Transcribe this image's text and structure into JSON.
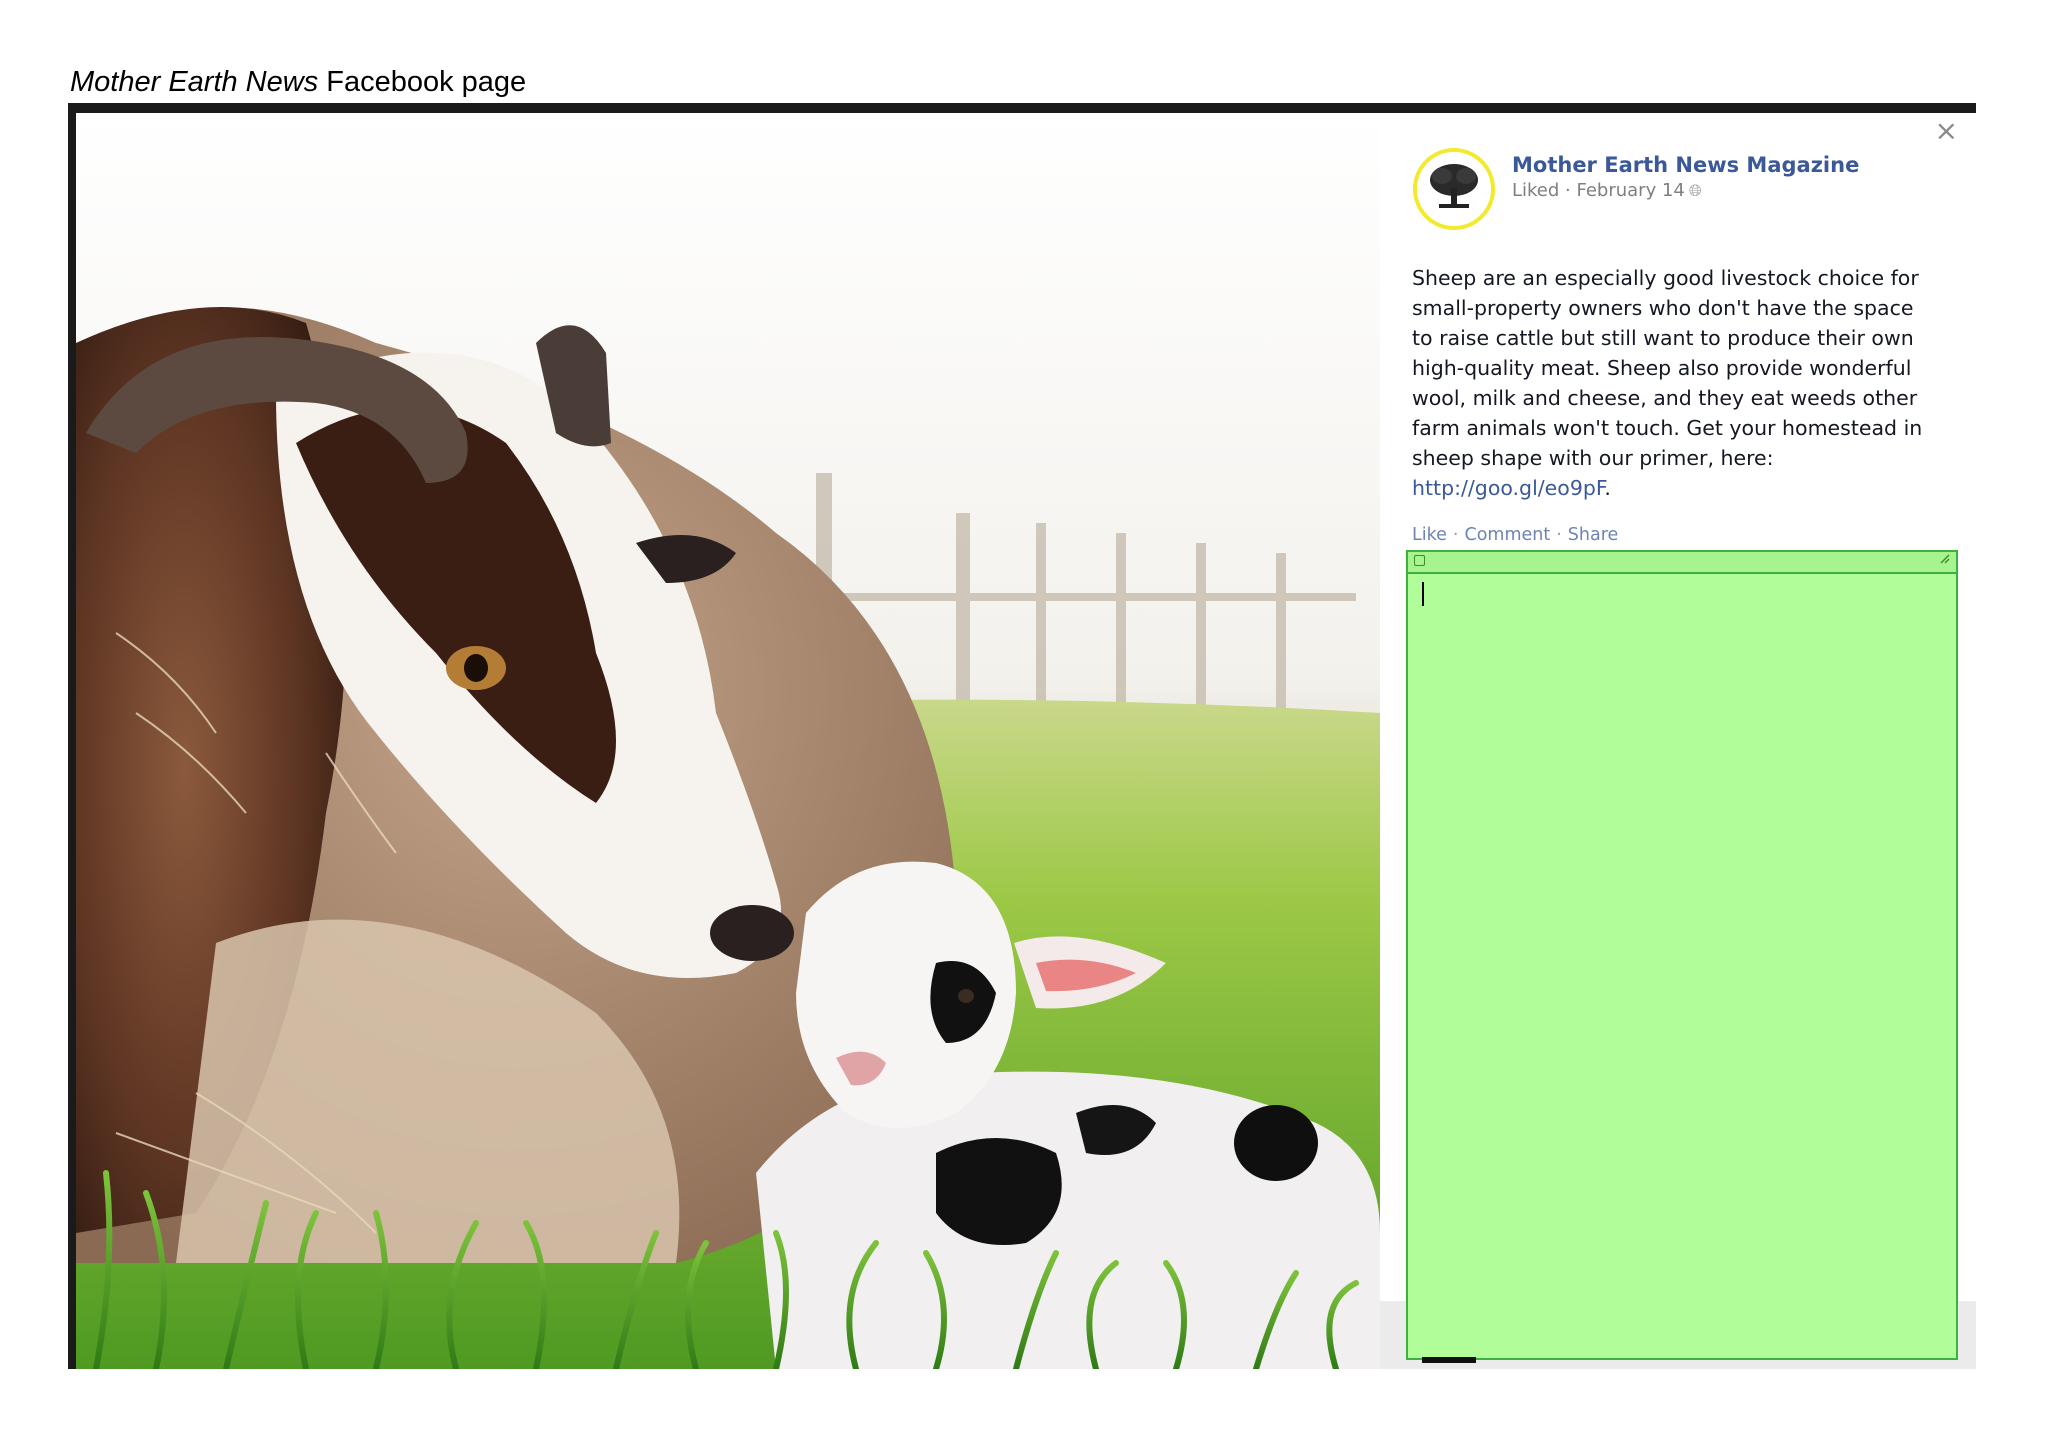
{
  "caption": {
    "italic": "Mother Earth News",
    "rest": " Facebook page"
  },
  "photo": {
    "subject": "ewe-and-lamb-in-grass"
  },
  "post": {
    "close_icon": "×",
    "page_name": "Mother Earth News Magazine",
    "meta_text": "Liked · February 14",
    "meta_icon": "globe-icon",
    "body_text": "Sheep are an especially good livestock choice for small-property owners who don't have the space to raise cattle but still want to produce their own high-quality meat. Sheep also provide wonderful wool, milk and cheese, and they eat weeds other farm animals won't touch. Get your homestead in sheep shape with our primer, here: ",
    "link_text": "http://goo.gl/eo9pF",
    "body_end": ".",
    "actions": [
      "Like",
      "Comment",
      "Share"
    ]
  },
  "comment_box": {
    "value": "",
    "color": "#b0fd9a",
    "border_color": "#3cb140"
  }
}
